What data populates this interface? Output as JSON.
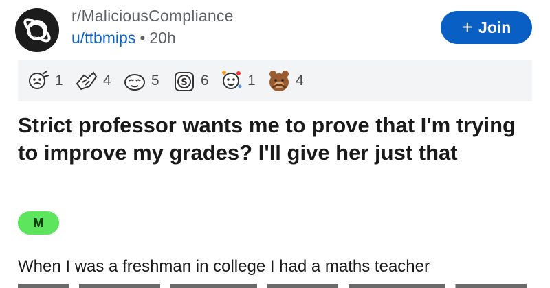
{
  "post": {
    "subreddit": "r/MaliciousCompliance",
    "author": "u/ttbmips",
    "separator": "•",
    "age": "20h",
    "join_label": "Join",
    "join_icon": "plus-icon",
    "awards": [
      {
        "icon": "award-1-icon",
        "count": "1"
      },
      {
        "icon": "award-2-icon",
        "count": "4"
      },
      {
        "icon": "award-3-icon",
        "count": "5"
      },
      {
        "icon": "award-4-icon",
        "count": "6"
      },
      {
        "icon": "award-5-icon",
        "count": "1"
      },
      {
        "icon": "award-6-icon",
        "count": "4"
      }
    ],
    "title": "Strict professor wants me to prove that I'm trying to improve my grades? I'll give her just that",
    "flair": "M",
    "body_first_line": "When I was a freshman in college I had a maths teacher"
  },
  "colors": {
    "accent": "#0a5fc4",
    "user_link": "#0a62c9",
    "flair_bg": "#5ee55e",
    "awards_bg": "#f3f4f6"
  }
}
